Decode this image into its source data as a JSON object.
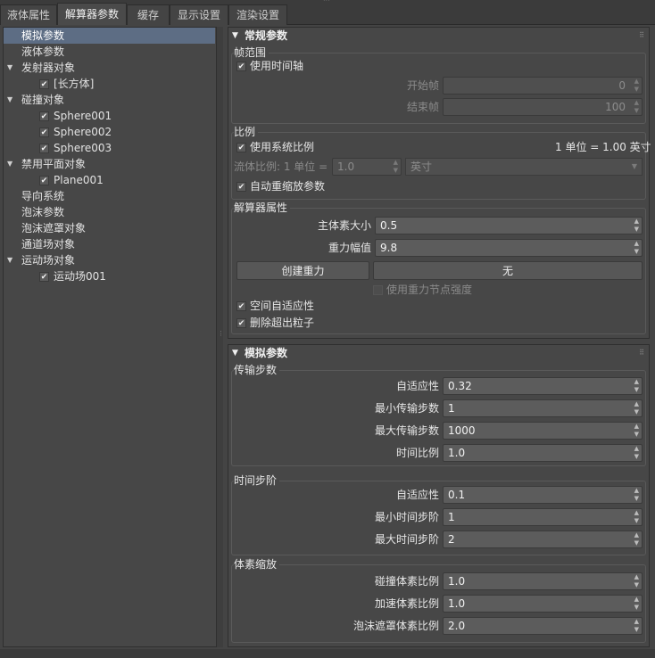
{
  "tabs": [
    "液体属性",
    "解算器参数",
    "缓存",
    "显示设置",
    "渲染设置"
  ],
  "tree": {
    "item1": "模拟参数",
    "item2": "液体参数",
    "emitters": "发射器对象",
    "emitter1": "[长方体]",
    "colliders": "碰撞对象",
    "collider1": "Sphere001",
    "collider2": "Sphere002",
    "collider3": "Sphere003",
    "killplanes": "禁用平面对象",
    "killplane1": "Plane001",
    "guide": "导向系统",
    "foam": "泡沫参数",
    "foammask": "泡沫遮罩对象",
    "channel": "通道场对象",
    "motion": "运动场对象",
    "motion1": "运动场001"
  },
  "general": {
    "title": "常规参数",
    "frame_range": "帧范围",
    "use_timeline": "使用时间轴",
    "start_frame_label": "开始帧",
    "start_frame": "0",
    "end_frame_label": "结束帧",
    "end_frame": "100",
    "scale": "比例",
    "use_system_scale": "使用系统比例",
    "unit_info": "1 单位 = 1.00 英寸",
    "fluid_scale_label": "流体比例: 1 单位 =",
    "fluid_scale": "1.0",
    "unit": "英寸",
    "auto_rescale": "自动重缩放参数",
    "solver_props": "解算器属性",
    "voxel_size_label": "主体素大小",
    "voxel_size": "0.5",
    "gravity_label": "重力幅值",
    "gravity": "9.8",
    "create_gravity": "创建重力",
    "gravity_node": "无",
    "use_gravity_strength": "使用重力节点强度",
    "spatial_adaptivity": "空间自适应性",
    "delete_out": "删除超出粒子"
  },
  "sim": {
    "title": "模拟参数",
    "transport_steps": "传输步数",
    "t_adaptivity_label": "自适应性",
    "t_adaptivity": "0.32",
    "min_transport_label": "最小传输步数",
    "min_transport": "1",
    "max_transport_label": "最大传输步数",
    "max_transport": "1000",
    "time_scale_label": "时间比例",
    "time_scale": "1.0",
    "time_steps": "时间步阶",
    "ts_adaptivity_label": "自适应性",
    "ts_adaptivity": "0.1",
    "min_time_label": "最小时间步阶",
    "min_time": "1",
    "max_time_label": "最大时间步阶",
    "max_time": "2",
    "voxel_scale": "体素缩放",
    "collision_voxel_label": "碰撞体素比例",
    "collision_voxel": "1.0",
    "accel_voxel_label": "加速体素比例",
    "accel_voxel": "1.0",
    "foam_voxel_label": "泡沫遮罩体素比例",
    "foam_voxel": "2.0"
  }
}
